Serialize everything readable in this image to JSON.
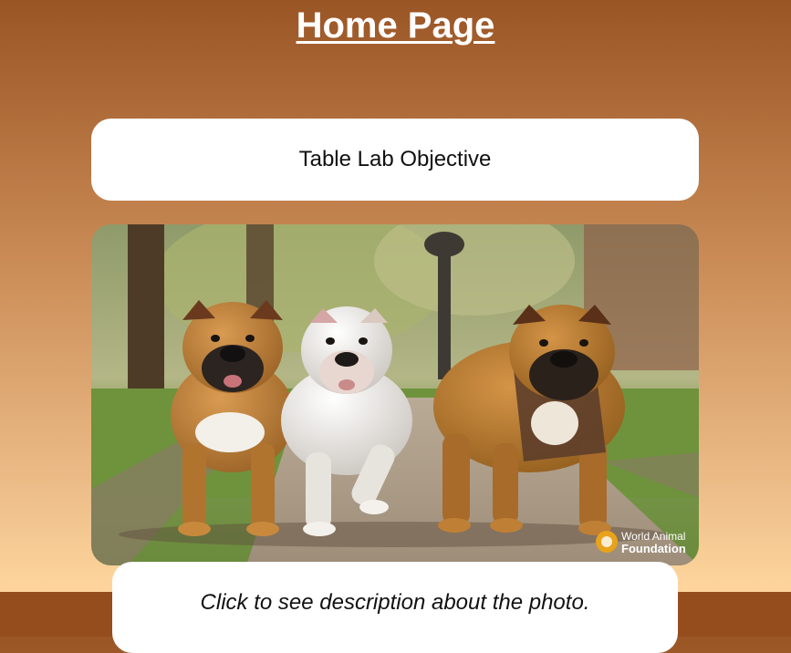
{
  "page": {
    "title": "Home Page"
  },
  "objective_card": {
    "label": "Table Lab Objective"
  },
  "photo": {
    "subject": "three bulldogs walking on a park path",
    "watermark": {
      "line1": "World Animal",
      "line2": "Foundation"
    }
  },
  "caption": {
    "text": "Click to see description about the photo."
  },
  "colors": {
    "header_brown": "#9a5525",
    "footer_brown": "#954d1e",
    "peach": "#fdd59c",
    "card_white": "#ffffff"
  }
}
